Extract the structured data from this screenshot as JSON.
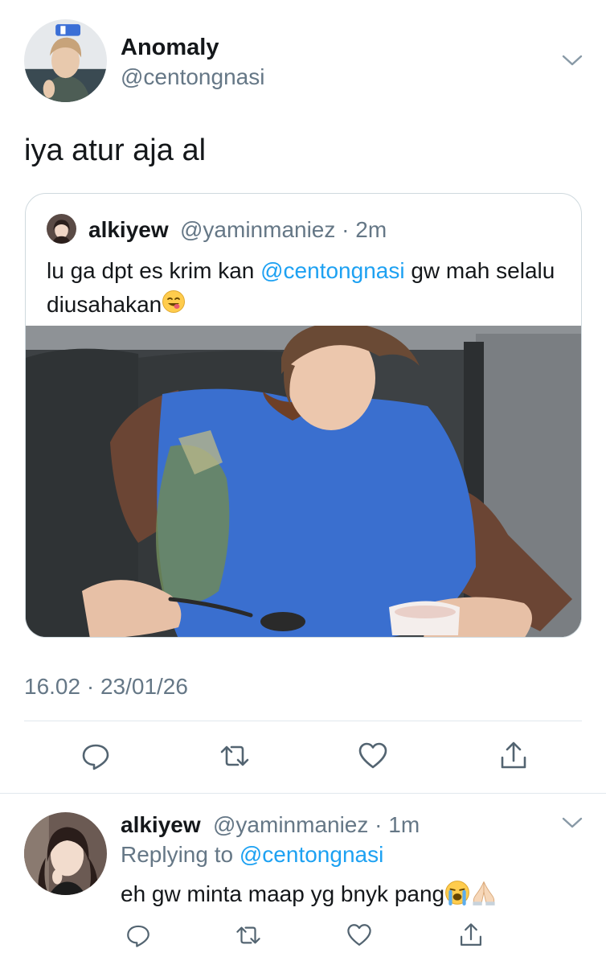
{
  "main_tweet": {
    "author_name": "Anomaly",
    "author_handle": "@centongnasi",
    "text": "iya atur aja al",
    "timestamp": "16.02 · 23/01/26"
  },
  "quoted_tweet": {
    "author_name": "alkiyew",
    "author_handle": "@yaminmaniez",
    "age": "2m",
    "text_before": "lu ga dpt es krim kan ",
    "mention": "@centongnasi",
    "text_after": " gw mah selalu diusahakan",
    "emoji": "face-savoring-food-emoji"
  },
  "actions": [
    {
      "name": "reply",
      "icon": "reply-icon"
    },
    {
      "name": "retweet",
      "icon": "retweet-icon"
    },
    {
      "name": "like",
      "icon": "heart-icon"
    },
    {
      "name": "share",
      "icon": "share-icon"
    }
  ],
  "reply_tweet": {
    "author_name": "alkiyew",
    "author_handle": "@yaminmaniez",
    "age": "1m",
    "replying_prefix": "Replying to ",
    "replying_to": "@centongnasi",
    "text": "eh gw minta maap yg bnyk pang",
    "emojis": [
      "loudly-crying-face-emoji",
      "folded-hands-emoji"
    ]
  },
  "colors": {
    "text": "#14171a",
    "secondary": "#657786",
    "link": "#1da1f2",
    "border": "#cfd9de"
  }
}
